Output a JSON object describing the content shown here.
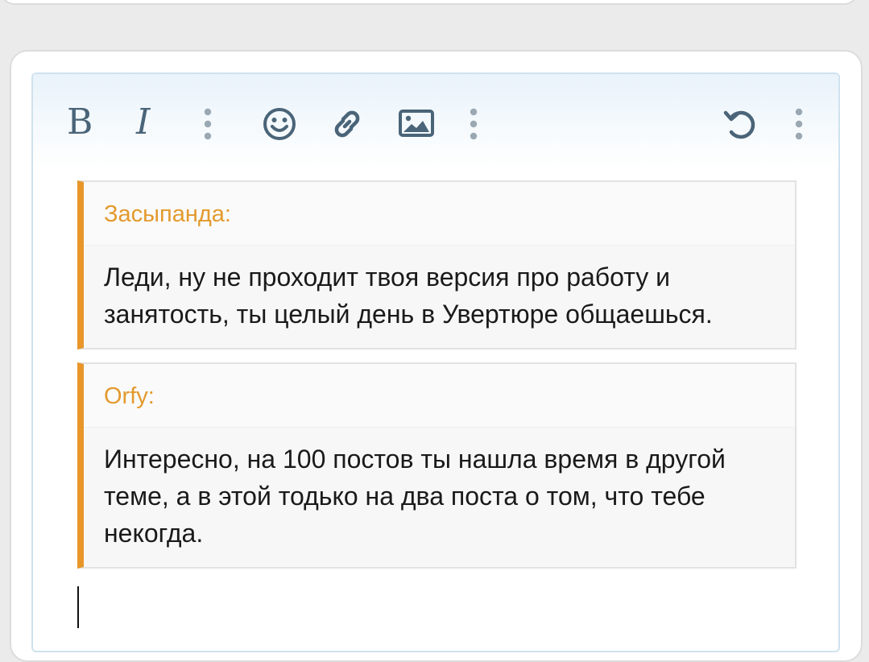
{
  "toolbar": {
    "bold_label": "B",
    "italic_label": "I",
    "icons": [
      "bold-icon",
      "italic-icon",
      "more-options-icon",
      "smiley-icon",
      "link-icon",
      "image-icon",
      "more-options-icon",
      "undo-icon",
      "more-options-icon"
    ],
    "icon_color": "#4a6478"
  },
  "quotes": [
    {
      "author": "Засыпанда:",
      "text": "Леди, ну не проходит твоя версия про работу и занятость, ты целый день в Увертюре общаешься."
    },
    {
      "author": "Orfy:",
      "text": "Интересно, на 100 постов ты нашла время в другой теме, а в этой тодько на два поста о том, что тебе некогда."
    }
  ],
  "colors": {
    "accent": "#e8962a",
    "author": "#e39a2d",
    "editor_border": "#cfe2ee",
    "background": "#ebebeb"
  }
}
